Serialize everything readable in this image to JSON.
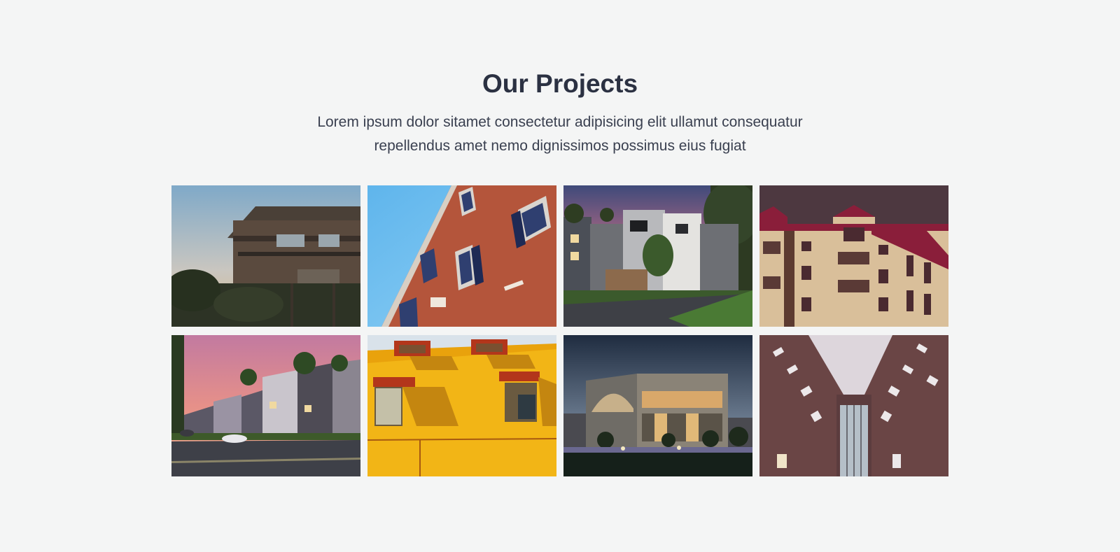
{
  "section": {
    "title": "Our Projects",
    "subtitle": "Lorem ipsum dolor sitamet consectetur adipisicing elit ullamut consequatur repellendus amet nemo dignissimos possimus eius fugiat"
  },
  "colors": {
    "background": "#f4f5f5",
    "title": "#2b3142",
    "subtitle": "#3a4050"
  },
  "projects": [
    {
      "icon": "wooden-house-photo"
    },
    {
      "icon": "orange-facade-photo"
    },
    {
      "icon": "townhouse-sunset-photo"
    },
    {
      "icon": "cream-apartment-photo"
    },
    {
      "icon": "townhouse-row-street-photo"
    },
    {
      "icon": "yellow-wall-windows-photo"
    },
    {
      "icon": "modern-building-night-photo"
    },
    {
      "icon": "brick-towers-photo"
    }
  ]
}
